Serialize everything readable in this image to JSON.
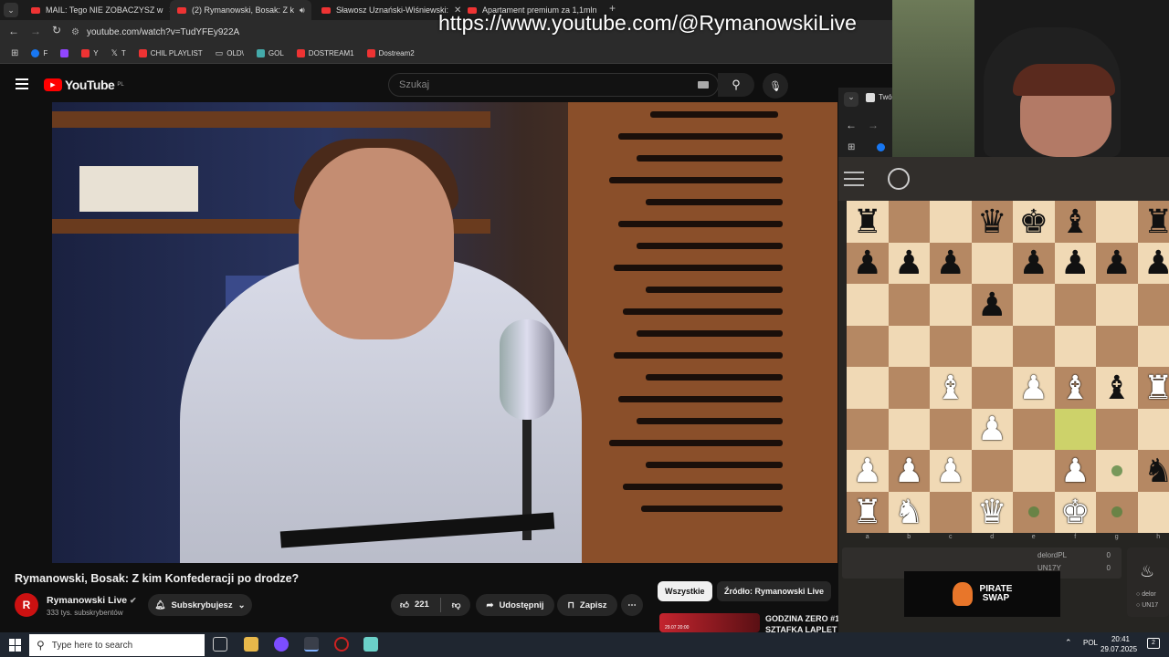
{
  "browser": {
    "tabs": [
      {
        "label": "MAIL: Tego NIE ZOBACZYSZ w",
        "active": false
      },
      {
        "label": "(2) Rymanowski, Bosak: Z k",
        "active": true
      },
      {
        "label": "Sławosz Uznański-Wiśniewski:",
        "active": false
      },
      {
        "label": "Apartament premium za 1,1mln",
        "active": false
      }
    ],
    "url": "youtube.com/watch?v=TudYFEy922A",
    "bookmarks": [
      "F",
      "Y",
      "T",
      "CHIL PLAYLIST",
      "OLD\\",
      "GOL",
      "DOSTREAM1",
      "Dostream2"
    ]
  },
  "overlay_url": "https://www.youtube.com/@RymanowskiLive",
  "youtube": {
    "logo_text": "YouTube",
    "region": "PL",
    "search_placeholder": "Szukaj",
    "video_title": "Rymanowski, Bosak: Z kim Konfederacji po drodze?",
    "channel": {
      "name": "Rymanowski Live",
      "subscribers": "333 tys. subskrybentów",
      "avatar_letter": "R"
    },
    "subscribe_label": "Subskrybujesz",
    "likes": "221",
    "share_label": "Udostępnij",
    "save_label": "Zapisz",
    "chips": [
      "Wszystkie",
      "Źródło: Rymanowski Live"
    ],
    "recommended": {
      "title": "GODZINA ZERO #1",
      "subtitle": "SZTAFKA LAPLET",
      "date": "29.07 20:00"
    }
  },
  "chess": {
    "tab_label": "Twó",
    "files": [
      "a",
      "b",
      "c",
      "d",
      "e",
      "f",
      "g",
      "h"
    ],
    "board": [
      [
        "br",
        "",
        "",
        "bq",
        "bk",
        "bb",
        "",
        "br"
      ],
      [
        "bp",
        "bp",
        "bp",
        "",
        "bp",
        "bp",
        "bp",
        "bp"
      ],
      [
        "",
        "",
        "",
        "bp",
        "",
        "",
        "",
        ""
      ],
      [
        "",
        "",
        "",
        "",
        "",
        "",
        "",
        ""
      ],
      [
        "",
        "",
        "wb",
        "",
        "wp",
        "wb",
        "bb",
        "wr"
      ],
      [
        "",
        "",
        "",
        "wp",
        "",
        "hl",
        "",
        ""
      ],
      [
        "wp",
        "wp",
        "wp",
        "",
        "",
        "wp",
        "dot",
        "bn"
      ],
      [
        "wr",
        "wn",
        "",
        "wq",
        "dot",
        "wk",
        "dot",
        ""
      ]
    ],
    "players": [
      {
        "name": "delordPL",
        "score": "0"
      },
      {
        "name": "UN17Y",
        "score": "0"
      }
    ],
    "side_labels": [
      "delor",
      "UN17"
    ],
    "sponsor_line1": "PIRATE",
    "sponsor_line2": "SWAP"
  },
  "taskbar": {
    "search_placeholder": "Type here to search",
    "lang": "POL",
    "time": "20:41",
    "date": "29.07.2025",
    "notifications": "2"
  }
}
